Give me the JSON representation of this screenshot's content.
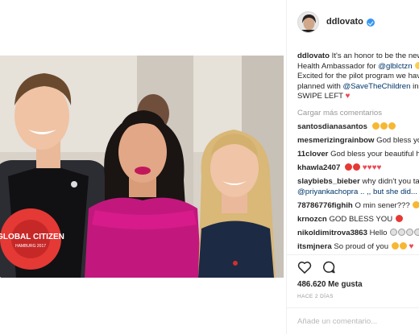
{
  "post": {
    "username": "ddlovato",
    "verified": true,
    "photo_description": "Three people posing together; a man in a Global Citizen t-shirt, a woman in a magenta dress, and a blonde woman in a navy dress",
    "photo_shirt_text": "GLOBAL CITIZEN",
    "photo_shirt_subtext": "HAMBURG 2017"
  },
  "caption": {
    "username": "ddlovato",
    "line1": "It's an honor to be the new",
    "line2_text": "Health Ambassador for ",
    "line2_mention": "@glblctzn",
    "line3": "Excited for the pilot program we hav",
    "line4_text": "planned with ",
    "line4_mention": "@SaveTheChildren",
    "line4_tail": " in",
    "line5": "SWIPE LEFT"
  },
  "load_more": "Cargar más comentarios",
  "comments": [
    {
      "username": "santosdianasantos",
      "text": ""
    },
    {
      "username": "mesmerizingrainbow",
      "text": "God bless you"
    },
    {
      "username": "11clover",
      "text": "God bless your beautiful he"
    },
    {
      "username": "khawla2407",
      "text": ""
    },
    {
      "username": "slaybiebs_bieber",
      "text": "why didn't you tag"
    },
    {
      "username": "",
      "text": "@priyankachopra .. ,, but she did..."
    },
    {
      "username": "78786776fighih",
      "text": "O min sener???"
    },
    {
      "username": "krnozcn",
      "text": "GOD BLESS YOU"
    },
    {
      "username": "nikoldimitrova3863",
      "text": "Hello"
    },
    {
      "username": "itsmjnera",
      "text": "So proud of you"
    }
  ],
  "actions": {
    "like_icon": "heart-outline-icon",
    "comment_icon": "comment-bubble-icon",
    "likes": "486.620 Me gusta",
    "timestamp": "HACE 2 DÍAS",
    "add_comment_placeholder": "Añade un comentario..."
  },
  "colors": {
    "mention": "#003569",
    "heart": "#ed4956",
    "muted": "#999999",
    "verified": "#3897f0"
  }
}
